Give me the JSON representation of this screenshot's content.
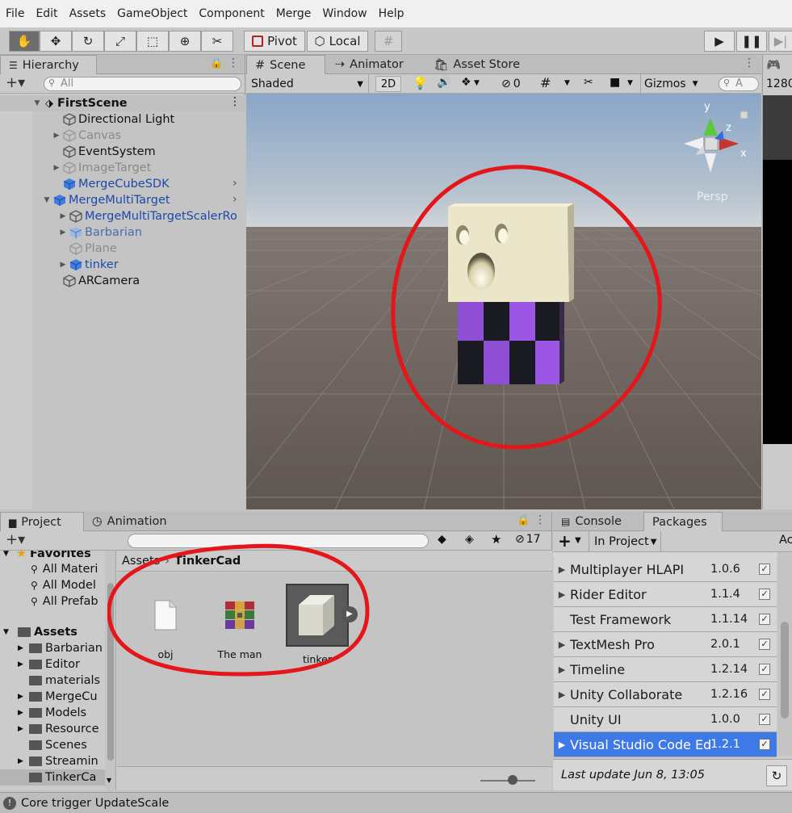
{
  "menu": [
    "File",
    "Edit",
    "Assets",
    "GameObject",
    "Component",
    "Merge",
    "Window",
    "Help"
  ],
  "toolbar": {
    "pivot": "Pivot",
    "local": "Local"
  },
  "hierarchy": {
    "tab": "Hierarchy",
    "search_placeholder": "All",
    "scene_name": "FirstScene",
    "items": [
      {
        "label": "Directional Light"
      },
      {
        "label": "Canvas"
      },
      {
        "label": "EventSystem"
      },
      {
        "label": "ImageTarget"
      },
      {
        "label": "MergeCubeSDK"
      },
      {
        "label": "MergeMultiTarget"
      },
      {
        "label": "MergeMultiTargetScalerRo"
      },
      {
        "label": "Barbarian"
      },
      {
        "label": "Plane"
      },
      {
        "label": "tinker"
      },
      {
        "label": "ARCamera"
      }
    ]
  },
  "scene": {
    "tabs": [
      "Scene",
      "Animator",
      "Asset Store"
    ],
    "shading": "Shaded",
    "mode_2d": "2D",
    "hidden_count": "0",
    "gizmos": "Gizmos",
    "search_placeholder": "A",
    "persp": "Persp",
    "axis": {
      "y": "y",
      "z": "z",
      "x": "x"
    },
    "resolution": "1280"
  },
  "project": {
    "tabs": [
      "Project",
      "Animation"
    ],
    "layer_count": "17",
    "favorites": "Favorites",
    "favorite_items": [
      "All Materi",
      "All Model",
      "All Prefab"
    ],
    "assets_label": "Assets",
    "folders": [
      "Barbarian",
      "Editor",
      "materials",
      "MergeCu",
      "Models",
      "Resource",
      "Scenes",
      "Streamin",
      "TinkerCa"
    ],
    "breadcrumb_root": "Assets",
    "breadcrumb_current": "TinkerCad",
    "files": [
      {
        "label": "obj"
      },
      {
        "label": "The man"
      },
      {
        "label": "tinker"
      }
    ]
  },
  "packages": {
    "tabs": [
      "Console",
      "Packages"
    ],
    "filter": "In Project",
    "cut_label": "Ac",
    "items": [
      {
        "name": "Multiplayer HLAPI",
        "version": "1.0.6",
        "arrow": true
      },
      {
        "name": "Rider Editor",
        "version": "1.1.4",
        "arrow": true
      },
      {
        "name": "Test Framework",
        "version": "1.1.14",
        "arrow": false
      },
      {
        "name": "TextMesh Pro",
        "version": "2.0.1",
        "arrow": true
      },
      {
        "name": "Timeline",
        "version": "1.2.14",
        "arrow": true
      },
      {
        "name": "Unity Collaborate",
        "version": "1.2.16",
        "arrow": true
      },
      {
        "name": "Unity UI",
        "version": "1.0.0",
        "arrow": false
      },
      {
        "name": "Visual Studio Code Ed",
        "version": "1.2.1",
        "arrow": true
      }
    ],
    "last_update": "Last update Jun 8, 13:05"
  },
  "statusbar": {
    "message": "Core trigger UpdateScale"
  },
  "colors": {
    "selection": "#3d7ae8",
    "annotation": "#e4161a",
    "link_blue": "#1d4aa8"
  }
}
